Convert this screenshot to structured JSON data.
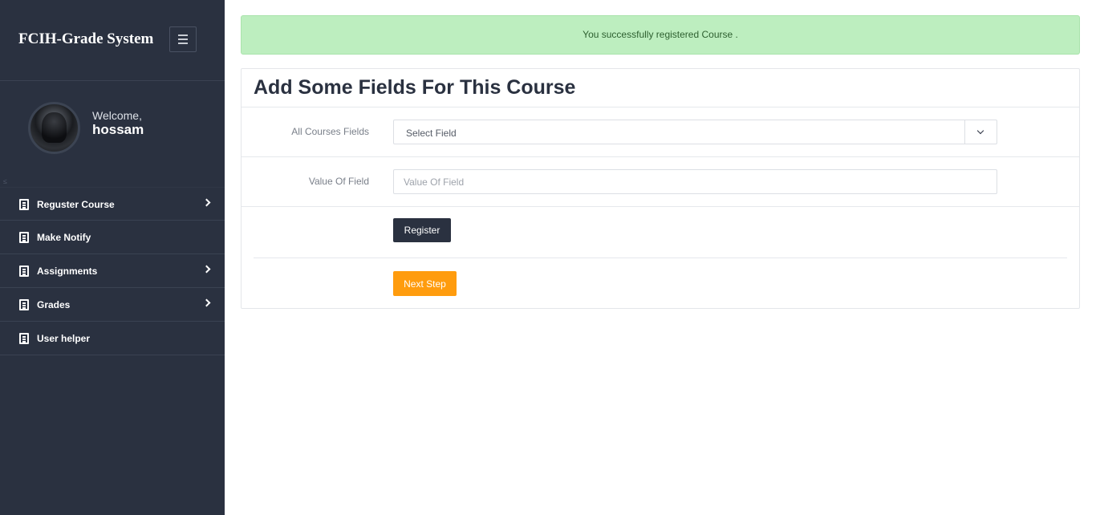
{
  "sidebar": {
    "brand": "FCIH-Grade System",
    "welcome": "Welcome,",
    "username": "hossam",
    "items": [
      {
        "label": "Reguster Course",
        "has_submenu": true,
        "icon": "document-icon"
      },
      {
        "label": "Make Notify",
        "has_submenu": false,
        "icon": "document-icon"
      },
      {
        "label": "Assignments",
        "has_submenu": true,
        "icon": "document-icon"
      },
      {
        "label": "Grades",
        "has_submenu": true,
        "icon": "document-icon"
      },
      {
        "label": "User helper",
        "has_submenu": false,
        "icon": "document-icon"
      }
    ]
  },
  "alert": {
    "message": "You successfully registered Course ."
  },
  "panel": {
    "title": "Add Some Fields For This Course",
    "field_select": {
      "label": "All Courses Fields",
      "selected": "Select Field"
    },
    "field_value": {
      "label": "Value Of Field",
      "placeholder": "Value Of Field",
      "value": ""
    },
    "register_label": "Register",
    "next_label": "Next Step"
  },
  "colors": {
    "sidebar_bg": "#2a3140",
    "alert_bg": "#bdeebf",
    "primary_button": "#2a3140",
    "accent_button": "#ff9c0e"
  }
}
